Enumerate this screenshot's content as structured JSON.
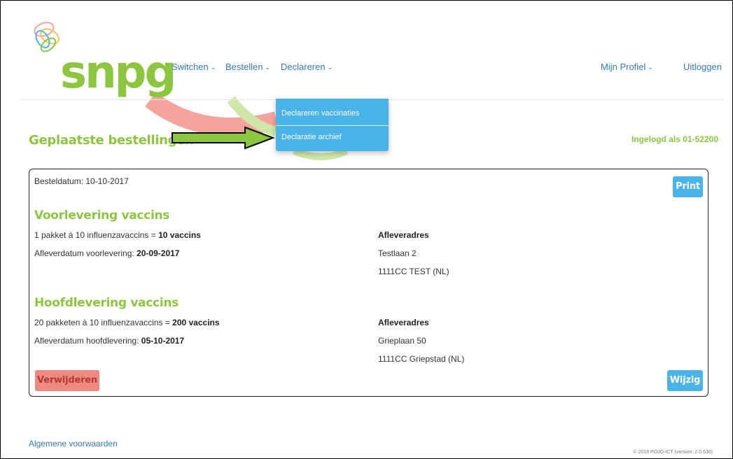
{
  "header": {
    "logo_text": "snpg",
    "nav": {
      "switchen": "Switchen",
      "bestellen": "Bestellen",
      "declareren": "Declareren",
      "mijn_profiel": "Mijn Profiel",
      "uitloggen": "Uitloggen"
    }
  },
  "dropdown": {
    "items": [
      "Declareren vaccinaties",
      "Declaratie archief"
    ]
  },
  "page": {
    "title": "Geplaatste bestellingen",
    "logged_in": "Ingelogd als 01-52200"
  },
  "order": {
    "besteldatum": "Besteldatum: 10-10-2017",
    "print_label": "Print",
    "voorlevering": {
      "title": "Voorlevering vaccins",
      "line1_prefix": "1 pakket à 10 influenzavaccins =",
      "line1_bold": "10 vaccins",
      "date_prefix": "Afleverdatum voorlevering:",
      "date_value": "20-09-2017",
      "address_heading": "Afleveradres",
      "address_lines": [
        "Testlaan 2",
        "1111CC TEST (NL)"
      ]
    },
    "hoofdlevering": {
      "title": "Hoofdlevering vaccins",
      "line1_prefix": "20 pakketen à 10 influenzavaccins =",
      "line1_bold": "200 vaccins",
      "date_prefix": "Afleverdatum hoofdlevering:",
      "date_value": "05-10-2017",
      "address_heading": "Afleveradres",
      "address_lines": [
        "Grieplaan 50",
        "1111CC Griepstad (NL)"
      ]
    },
    "delete_label": "Verwijderen",
    "edit_label": "Wijzig"
  },
  "footer": {
    "terms": "Algemene voorwaarden",
    "copyright": "© 2016 POJO-ICT (version: 2.0.630)"
  },
  "colors": {
    "brand_green": "#8cc63f",
    "accent_blue": "#4ab3e7",
    "danger_red": "#f08a80",
    "link_blue": "#337ab7"
  }
}
